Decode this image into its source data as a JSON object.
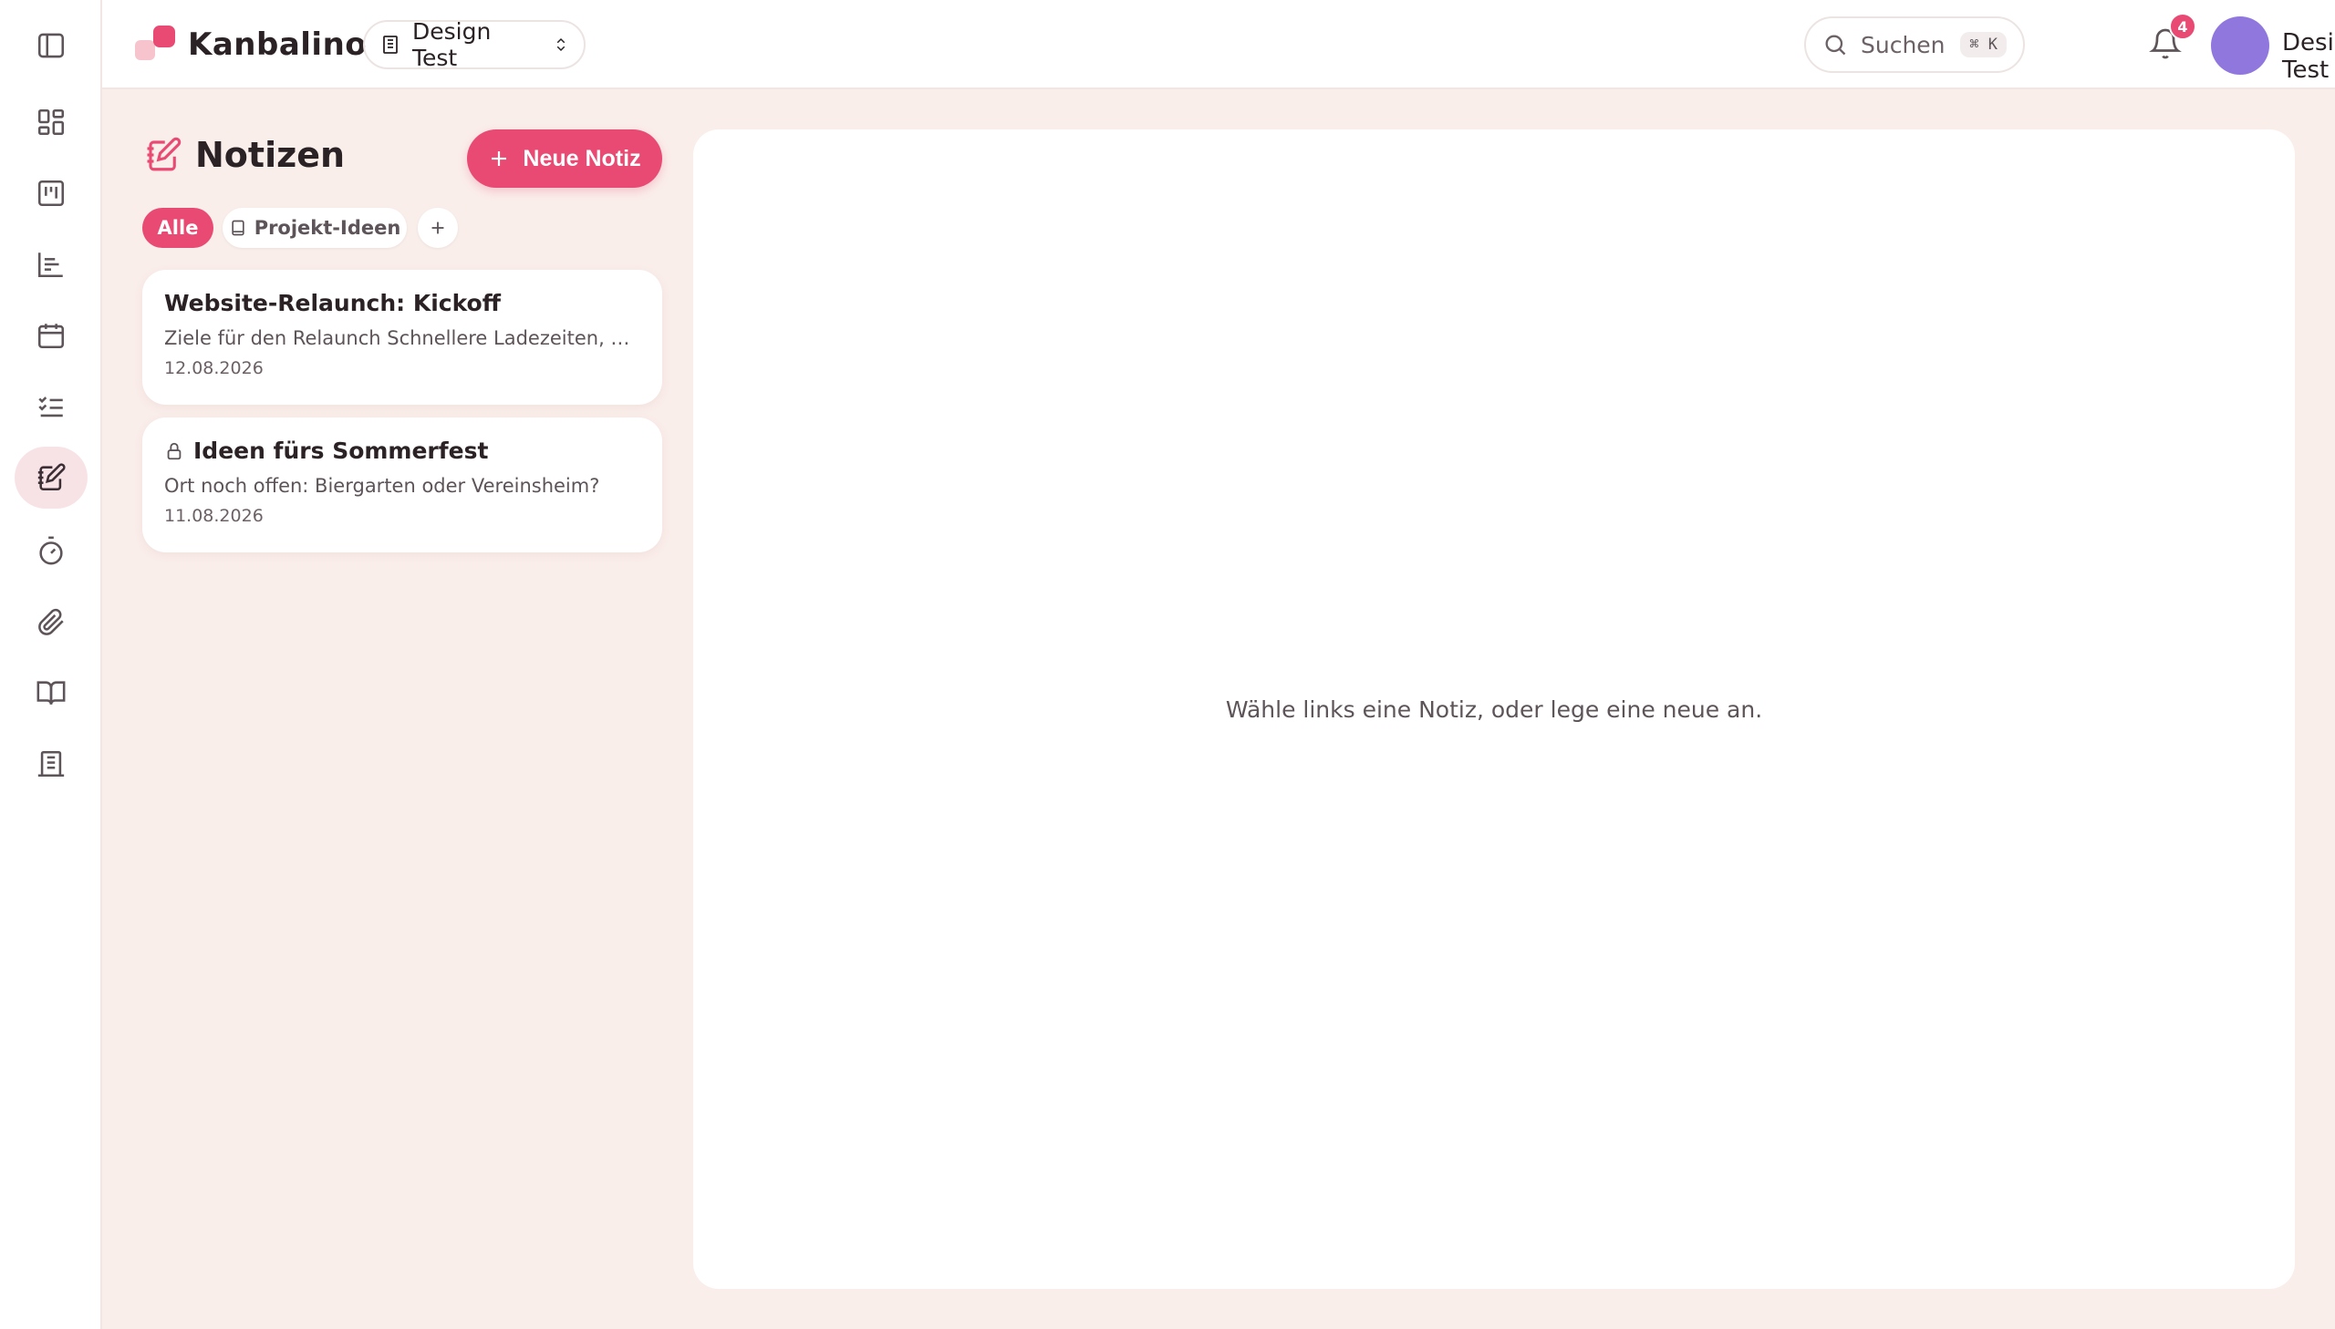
{
  "header": {
    "app_name": "Kanbalino",
    "workspace": "Design Test",
    "search_label": "Suchen",
    "search_shortcut": "⌘ K",
    "notifications_count": "4",
    "user_name": "Design Test",
    "avatar_color": "#9077de"
  },
  "sidebar": {
    "items": [
      {
        "icon": "sidebar-toggle-icon"
      },
      {
        "icon": "dashboard-icon"
      },
      {
        "icon": "kanban-board-icon"
      },
      {
        "icon": "chart-icon"
      },
      {
        "icon": "calendar-icon"
      },
      {
        "icon": "tasks-icon"
      },
      {
        "icon": "notes-icon",
        "active": true
      },
      {
        "icon": "timer-icon"
      },
      {
        "icon": "attachment-icon"
      },
      {
        "icon": "book-icon"
      },
      {
        "icon": "building-icon"
      }
    ]
  },
  "notes": {
    "title": "Notizen",
    "new_button": "Neue Notiz",
    "filters": [
      "Alle",
      "Projekt-Ideen"
    ],
    "items": [
      {
        "title": "Website-Relaunch: Kickoff",
        "preview": "Ziele für den Relaunch Schnellere Ladezeiten, klarere...",
        "date": "12.08.2026",
        "locked": false
      },
      {
        "title": "Ideen fürs Sommerfest",
        "preview": "Ort noch offen: Biergarten oder Vereinsheim?",
        "date": "11.08.2026",
        "locked": true
      }
    ]
  },
  "main": {
    "empty_message": "Wähle links eine Notiz, oder lege eine neue an."
  },
  "colors": {
    "accent": "#e94a73",
    "background": "#faeeea"
  }
}
